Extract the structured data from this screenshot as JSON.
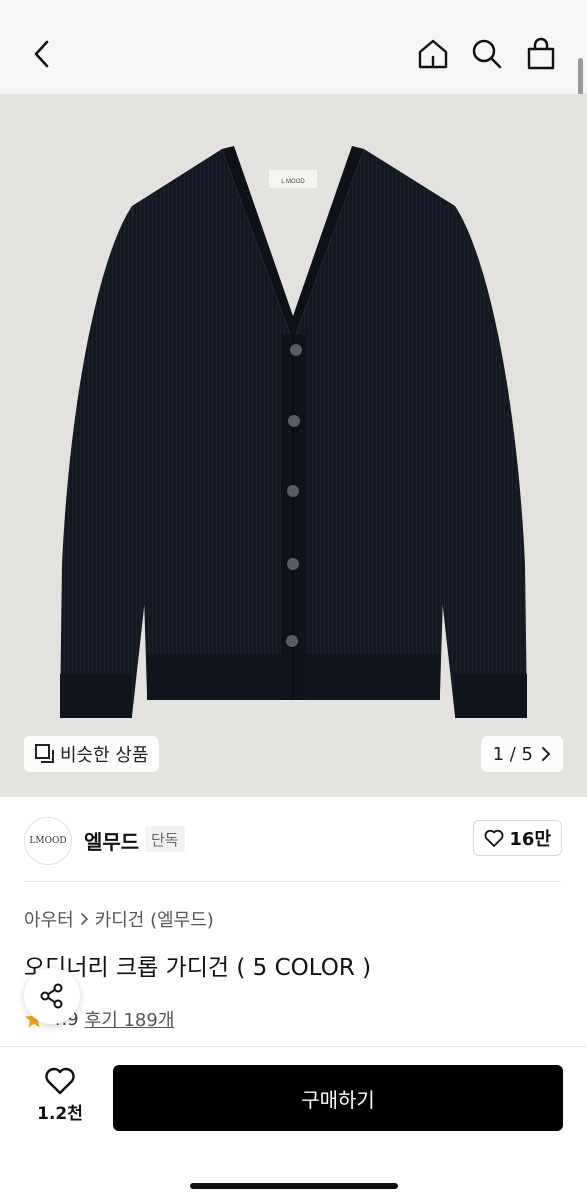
{
  "header": {
    "back_icon": "chevron-left-icon",
    "home_icon": "home-icon",
    "search_icon": "search-icon",
    "bag_icon": "shopping-bag-icon"
  },
  "hero": {
    "image_subject": "navy v-neck cardigan",
    "similar_label": "비슷한 상품",
    "counter": "1 / 5",
    "garment_color": "#141822"
  },
  "brand": {
    "logo_text": "LMOOD",
    "name": "엘무드",
    "badge": "단독",
    "likes": "16만"
  },
  "product": {
    "breadcrumb": [
      "아우터",
      "카디건 (엘무드)"
    ],
    "title": "오디너리 크롭 가디건 ( 5 COLOR )",
    "rating": "4.9",
    "reviews": "후기 189개"
  },
  "bottom": {
    "wish_count": "1.2천",
    "buy_label": "구매하기"
  },
  "colors": {
    "accent": "#000000",
    "star": "#f5a623"
  }
}
